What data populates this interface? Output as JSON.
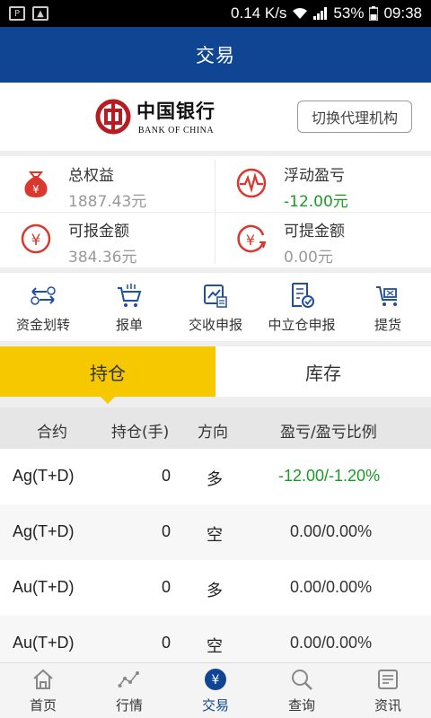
{
  "status_bar": {
    "speed": "0.14 K/s",
    "battery": "53%",
    "time": "09:38"
  },
  "header": {
    "title": "交易"
  },
  "bank": {
    "name_cn": "中国银行",
    "name_en": "BANK OF CHINA",
    "switch_label": "切换代理机构",
    "brand_color": "#b81c22"
  },
  "stats": [
    {
      "label": "总权益",
      "value": "1887.43元",
      "icon": "money-bag-icon"
    },
    {
      "label": "浮动盈亏",
      "value": "-12.00元",
      "icon": "pulse-icon"
    },
    {
      "label": "可报金额",
      "value": "384.36元",
      "icon": "yen-circle-icon"
    },
    {
      "label": "可提金额",
      "value": "0.00元",
      "icon": "yen-refresh-icon"
    }
  ],
  "actions": [
    {
      "label": "资金划转",
      "icon": "transfer-icon"
    },
    {
      "label": "报单",
      "icon": "cart-icon"
    },
    {
      "label": "交收申报",
      "icon": "chart-doc-icon"
    },
    {
      "label": "中立仓申报",
      "icon": "doc-check-icon"
    },
    {
      "label": "提货",
      "icon": "delivery-cart-icon"
    }
  ],
  "tabs": {
    "holdings": "持仓",
    "inventory": "库存"
  },
  "table": {
    "headers": {
      "contract": "合约",
      "position": "持仓(手)",
      "direction": "方向",
      "pnl": "盈亏/盈亏比例"
    },
    "rows": [
      {
        "contract": "Ag(T+D)",
        "position": "0",
        "direction": "多",
        "pnl": "-12.00/-1.20%"
      },
      {
        "contract": "Ag(T+D)",
        "position": "0",
        "direction": "空",
        "pnl": "0.00/0.00%"
      },
      {
        "contract": "Au(T+D)",
        "position": "0",
        "direction": "多",
        "pnl": "0.00/0.00%"
      },
      {
        "contract": "Au(T+D)",
        "position": "0",
        "direction": "空",
        "pnl": "0.00/0.00%"
      }
    ]
  },
  "bottom_nav": [
    {
      "label": "首页",
      "icon": "home-icon"
    },
    {
      "label": "行情",
      "icon": "line-chart-icon"
    },
    {
      "label": "交易",
      "icon": "yen-badge-icon"
    },
    {
      "label": "查询",
      "icon": "search-icon"
    },
    {
      "label": "资讯",
      "icon": "news-icon"
    }
  ],
  "colors": {
    "primary": "#0f4592",
    "accent": "#f5c800",
    "loss_green": "#1a9a24",
    "icon_red": "#d9382e",
    "icon_blue": "#1f4f9e"
  }
}
